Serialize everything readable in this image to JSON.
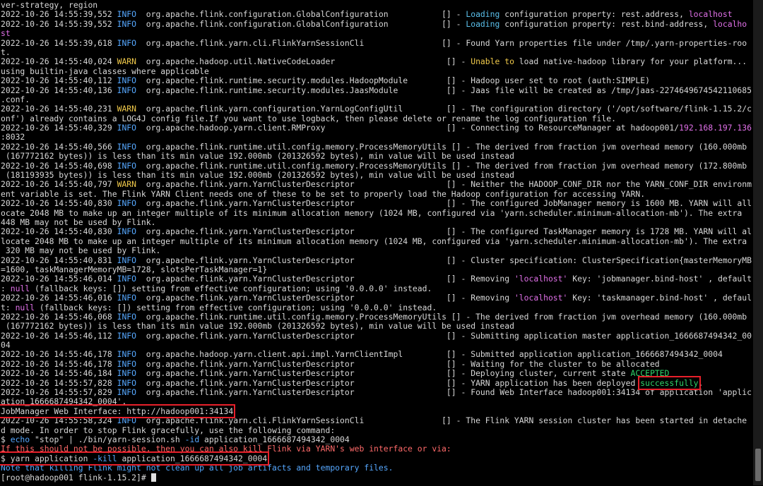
{
  "terminal": {
    "prompt": "[root@hadoop001 flink-1.15.2]# ",
    "lines": [
      [
        {
          "t": "ver-strategy, region"
        }
      ],
      [
        {
          "t": "2022-10-26 14:55:39,552 "
        },
        {
          "t": "INFO ",
          "c": "info"
        },
        {
          "t": " org.apache.flink.configuration.GlobalConfiguration           [] - "
        },
        {
          "t": "Loading",
          "c": "hl-cyan"
        },
        {
          "t": " configuration property: rest.address, "
        },
        {
          "t": "localhost",
          "c": "hl-magenta"
        }
      ],
      [
        {
          "t": "2022-10-26 14:55:39,552 "
        },
        {
          "t": "INFO ",
          "c": "info"
        },
        {
          "t": " org.apache.flink.configuration.GlobalConfiguration           [] - "
        },
        {
          "t": "Loading",
          "c": "hl-cyan"
        },
        {
          "t": " configuration property: rest.bind-address, "
        },
        {
          "t": "localho",
          "c": "hl-magenta"
        }
      ],
      [
        {
          "t": "st",
          "c": "hl-magenta"
        }
      ],
      [
        {
          "t": "2022-10-26 14:55:39,618 "
        },
        {
          "t": "INFO ",
          "c": "info"
        },
        {
          "t": " org.apache.flink.yarn.cli.FlinkYarnSessionCli                [] - Found Yarn properties file under /tmp/.yarn-properties-roo"
        }
      ],
      [
        {
          "t": "t."
        }
      ],
      [
        {
          "t": "2022-10-26 14:55:40,024 "
        },
        {
          "t": "WARN ",
          "c": "warn"
        },
        {
          "t": " org.apache.hadoop.util.NativeCodeLoader                       [] - "
        },
        {
          "t": "Unable to",
          "c": "hl-yellow"
        },
        {
          "t": " load native-hadoop library for your platform..."
        }
      ],
      [
        {
          "t": "using builtin-java classes where applicable"
        }
      ],
      [
        {
          "t": "2022-10-26 14:55:40,112 "
        },
        {
          "t": "INFO ",
          "c": "info"
        },
        {
          "t": " org.apache.flink.runtime.security.modules.HadoopModule        [] - Hadoop user set to root (auth:SIMPLE)"
        }
      ],
      [
        {
          "t": "2022-10-26 14:55:40,136 "
        },
        {
          "t": "INFO ",
          "c": "info"
        },
        {
          "t": " org.apache.flink.runtime.security.modules.JaasModule          [] - Jaas file will be created as /tmp/jaas-2274649674542110685"
        }
      ],
      [
        {
          "t": ".conf."
        }
      ],
      [
        {
          "t": "2022-10-26 14:55:40,231 "
        },
        {
          "t": "WARN ",
          "c": "warn"
        },
        {
          "t": " org.apache.flink.yarn.configuration.YarnLogConfigUtil         [] - The configuration directory ('/opt/software/flink-1.15.2/c"
        }
      ],
      [
        {
          "t": "onf') already contains a LOG4J config file.If you want to use logback, then please delete or rename the log configuration file."
        }
      ],
      [
        {
          "t": "2022-10-26 14:55:40,329 "
        },
        {
          "t": "INFO ",
          "c": "info"
        },
        {
          "t": " org.apache.hadoop.yarn.client.RMProxy                         [] - Connecting to ResourceManager at hadoop001/"
        },
        {
          "t": "192.168.197.136",
          "c": "hl-magenta"
        }
      ],
      [
        {
          "t": ":8032"
        }
      ],
      [
        {
          "t": "2022-10-26 14:55:40,566 "
        },
        {
          "t": "INFO ",
          "c": "info"
        },
        {
          "t": " org.apache.flink.runtime.util.config.memory.ProcessMemoryUtils [] - The derived from fraction jvm overhead memory (160.000mb"
        }
      ],
      [
        {
          "t": " (167772162 bytes)) is less than its min value 192.000mb (201326592 bytes), min value will be used instead"
        }
      ],
      [
        {
          "t": "2022-10-26 14:55:40,698 "
        },
        {
          "t": "INFO ",
          "c": "info"
        },
        {
          "t": " org.apache.flink.runtime.util.config.memory.ProcessMemoryUtils [] - The derived from fraction jvm overhead memory (172.800mb"
        }
      ],
      [
        {
          "t": " (181193935 bytes)) is less than its min value 192.000mb (201326592 bytes), min value will be used instead"
        }
      ],
      [
        {
          "t": "2022-10-26 14:55:40,797 "
        },
        {
          "t": "WARN ",
          "c": "warn"
        },
        {
          "t": " org.apache.flink.yarn.YarnClusterDescriptor                   [] - Neither the HADOOP_CONF_DIR nor the YARN_CONF_DIR environm"
        }
      ],
      [
        {
          "t": "ent variable is set. The Flink YARN Client needs one of these to be set to properly load the Hadoop configuration for accessing YARN."
        }
      ],
      [
        {
          "t": "2022-10-26 14:55:40,830 "
        },
        {
          "t": "INFO ",
          "c": "info"
        },
        {
          "t": " org.apache.flink.yarn.YarnClusterDescriptor                   [] - The configured JobManager memory is 1600 MB. YARN will all"
        }
      ],
      [
        {
          "t": "ocate 2048 MB to make up an integer multiple of its minimum allocation memory (1024 MB, configured via 'yarn.scheduler.minimum-allocation-mb'). The extra"
        }
      ],
      [
        {
          "t": "448 MB may not be used by Flink."
        }
      ],
      [
        {
          "t": "2022-10-26 14:55:40,830 "
        },
        {
          "t": "INFO ",
          "c": "info"
        },
        {
          "t": " org.apache.flink.yarn.YarnClusterDescriptor                   [] - The configured TaskManager memory is 1728 MB. YARN will al"
        }
      ],
      [
        {
          "t": "locate 2048 MB to make up an integer multiple of its minimum allocation memory (1024 MB, configured via 'yarn.scheduler.minimum-allocation-mb'). The extra"
        }
      ],
      [
        {
          "t": " 320 MB may not be used by Flink."
        }
      ],
      [
        {
          "t": "2022-10-26 14:55:40,831 "
        },
        {
          "t": "INFO ",
          "c": "info"
        },
        {
          "t": " org.apache.flink.yarn.YarnClusterDescriptor                   [] - Cluster specification: ClusterSpecification{masterMemoryMB"
        }
      ],
      [
        {
          "t": "=1600, taskManagerMemoryMB=1728, slotsPerTaskManager=1}"
        }
      ],
      [
        {
          "t": "2022-10-26 14:55:46,014 "
        },
        {
          "t": "INFO ",
          "c": "info"
        },
        {
          "t": " org.apache.flink.yarn.YarnClusterDescriptor                   [] - Removing "
        },
        {
          "t": "'localhost'",
          "c": "hl-magenta"
        },
        {
          "t": " Key: 'jobmanager.bind-host' , default"
        }
      ],
      [
        {
          "t": ": "
        },
        {
          "t": "null",
          "c": "hl-magenta"
        },
        {
          "t": " (fallback keys: []) setting from effective configuration; using '0.0.0.0' instead."
        }
      ],
      [
        {
          "t": "2022-10-26 14:55:46,016 "
        },
        {
          "t": "INFO ",
          "c": "info"
        },
        {
          "t": " org.apache.flink.yarn.YarnClusterDescriptor                   [] - Removing "
        },
        {
          "t": "'localhost'",
          "c": "hl-magenta"
        },
        {
          "t": " Key: 'taskmanager.bind-host' , defaul"
        }
      ],
      [
        {
          "t": "t: "
        },
        {
          "t": "null",
          "c": "hl-magenta"
        },
        {
          "t": " (fallback keys: []) setting from effective configuration; using '0.0.0.0' instead."
        }
      ],
      [
        {
          "t": "2022-10-26 14:55:46,068 "
        },
        {
          "t": "INFO ",
          "c": "info"
        },
        {
          "t": " org.apache.flink.runtime.util.config.memory.ProcessMemoryUtils [] - The derived from fraction jvm overhead memory (160.000mb"
        }
      ],
      [
        {
          "t": " (167772162 bytes)) is less than its min value 192.000mb (201326592 bytes), min value will be used instead"
        }
      ],
      [
        {
          "t": "2022-10-26 14:55:46,112 "
        },
        {
          "t": "INFO ",
          "c": "info"
        },
        {
          "t": " org.apache.flink.yarn.YarnClusterDescriptor                   [] - Submitting application master application_1666687494342_00"
        }
      ],
      [
        {
          "t": "04"
        }
      ],
      [
        {
          "t": "2022-10-26 14:55:46,178 "
        },
        {
          "t": "INFO ",
          "c": "info"
        },
        {
          "t": " org.apache.hadoop.yarn.client.api.impl.YarnClientImpl         [] - Submitted application application_1666687494342_0004"
        }
      ],
      [
        {
          "t": "2022-10-26 14:55:46,178 "
        },
        {
          "t": "INFO ",
          "c": "info"
        },
        {
          "t": " org.apache.flink.yarn.YarnClusterDescriptor                   [] - Waiting for the cluster to be allocated"
        }
      ],
      [
        {
          "t": "2022-10-26 14:55:46,184 "
        },
        {
          "t": "INFO ",
          "c": "info"
        },
        {
          "t": " org.apache.flink.yarn.YarnClusterDescriptor                   [] - Deploying cluster, current state "
        },
        {
          "t": "ACCEPTED",
          "c": "hl-green"
        }
      ],
      [
        {
          "t": "2022-10-26 14:55:57,828 "
        },
        {
          "t": "INFO ",
          "c": "info"
        },
        {
          "t": " org.apache.flink.yarn.YarnClusterDescriptor                   [] - YARN application has been deployed "
        },
        {
          "t": "successfully",
          "c": "hl-green",
          "box": true
        },
        {
          "t": "."
        }
      ],
      [
        {
          "t": "2022-10-26 14:55:57,829 "
        },
        {
          "t": "INFO ",
          "c": "info"
        },
        {
          "t": " org.apache.flink.yarn.YarnClusterDescriptor                   [] - Found Web Interface hadoop001:34134 of application 'applic"
        }
      ],
      [
        {
          "t": "ation_1666687494342_0004'."
        }
      ],
      [
        {
          "t": "JobManager Web Interface: http://hadoop001:34134",
          "box": true
        }
      ],
      [
        {
          "t": "2022-10-26 14:55:58,324 "
        },
        {
          "t": "INFO ",
          "c": "info"
        },
        {
          "t": " org.apache.flink.yarn.cli.FlinkYarnSessionCli                [] - The Flink YARN session cluster has been started in detache"
        }
      ],
      [
        {
          "t": "d mode. In order to stop Flink gracefully, use the following command:"
        }
      ],
      [
        {
          "t": "$ "
        },
        {
          "t": "echo",
          "c": "hl-blue"
        },
        {
          "t": " \"stop\" | ./bin/yarn-session.sh "
        },
        {
          "t": "-id",
          "c": "hl-blue"
        },
        {
          "t": " application_1666687494342_0004"
        }
      ],
      [
        {
          "t": "If this should not be possible, then you can also kill Flink via YARN's web interface or via:",
          "c": "hl-red"
        }
      ],
      [
        {
          "t": "$ yarn application ",
          "box": "start"
        },
        {
          "t": "-kill",
          "c": "hl-blue",
          "box": "mid"
        },
        {
          "t": " application_1666687494342_0004",
          "box": "end"
        }
      ],
      [
        {
          "t": "Note that killing Flink might not clean up all job artifacts and temporary files.",
          "c": "hl-blue"
        }
      ]
    ]
  }
}
